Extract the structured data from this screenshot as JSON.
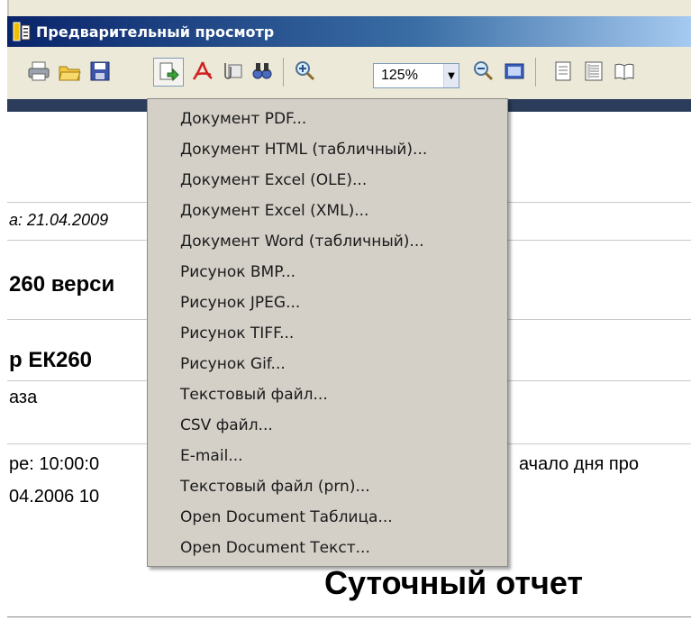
{
  "window": {
    "title": "Предварительный просмотр"
  },
  "toolbar": {
    "zoom_value": "125%",
    "buttons": [
      "print-icon",
      "open-icon",
      "save-icon",
      "export-icon",
      "pdf-icon",
      "mail-attach-icon",
      "find-icon",
      "zoom-in-icon",
      "zoom-out-icon",
      "page-width-icon",
      "page-icon",
      "multi-page-icon",
      "book-icon"
    ]
  },
  "export_menu": {
    "items": [
      "Документ PDF...",
      "Документ HTML (табличный)...",
      "Документ Excel (OLE)...",
      "Документ Excel (XML)...",
      "Документ Word (табличный)...",
      "Рисунок BMP...",
      "Рисунок JPEG...",
      "Рисунок TIFF...",
      "Рисунок Gif...",
      "Текстовый файл...",
      "CSV файл...",
      "E-mail...",
      "Текстовый файл (prn)...",
      "Open Document Таблица...",
      "Open Document Текст..."
    ]
  },
  "document": {
    "date_fragment": "а: 21.04.2009",
    "version_fragment": "260 верси",
    "device_fragment": "р ЕК260",
    "gas_fragment": "аза",
    "time_fragment": "ре: 10:00:0",
    "date2_fragment": "04.2006 10",
    "day_start_fragment": "ачало дня про",
    "report_title": "Суточный отчет"
  },
  "colors": {
    "titlebar": "#0a246a",
    "menu_bg": "#d4d0c8",
    "band": "#2b3d5b"
  }
}
